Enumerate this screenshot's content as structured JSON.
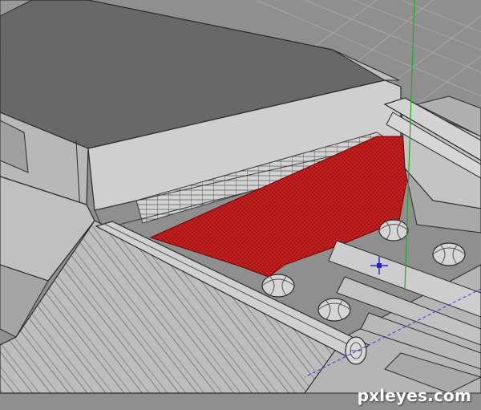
{
  "viewport": {
    "background_color": "#8f8f8f",
    "grid_color": "#a8a8a8",
    "surface_light": "#c9c9c9",
    "surface_mid": "#b3b3b3",
    "surface_dark": "#6e6e6e",
    "top_panel_color": "#686868",
    "edge_color": "#2a2a2a",
    "selection_color": "#c82020",
    "y_axis_color": "#22aa22",
    "x_axis_color": "#3a3acc",
    "pivot_color": "#2222cc"
  },
  "watermark": {
    "text": "pxleyes.com"
  }
}
